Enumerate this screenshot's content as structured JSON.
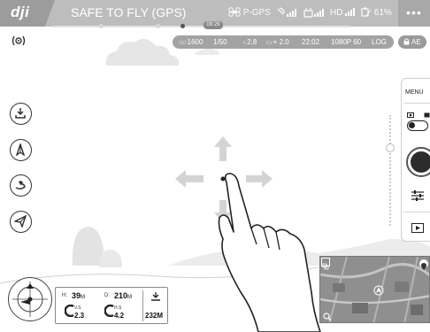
{
  "status_bar": {
    "brand": "dji",
    "flight_status": "SAFE TO FLY (GPS)",
    "flight_mode": "P-GPS",
    "hd_label": "HD",
    "battery": "61%",
    "menu_dots": "•••",
    "remaining_time": "09:29"
  },
  "camera_params": {
    "iso_label": "ISO",
    "iso": "1600",
    "shutter": "1/50",
    "aperture_label": "F",
    "aperture": "2.8",
    "ev_label": "EV",
    "ev": "+ 2.0",
    "record_time": "22:02",
    "video_res": "1080P 60",
    "color_profile": "LOG",
    "ae_lock": "AE"
  },
  "camera_panel": {
    "menu_label": "MENU"
  },
  "telemetry": {
    "height_label": "H:",
    "height": "39",
    "distance_label": "D:",
    "distance": "210",
    "vs_label": "V.S",
    "vs_value": "2.3",
    "hs_label": "H.S",
    "hs_value": "4.2",
    "unit_m": "M",
    "home_distance": "232M"
  },
  "colors": {
    "topbar": "#bdbdbd",
    "pill": "#a3a3a3",
    "accent_dark": "#2c2c2c"
  }
}
